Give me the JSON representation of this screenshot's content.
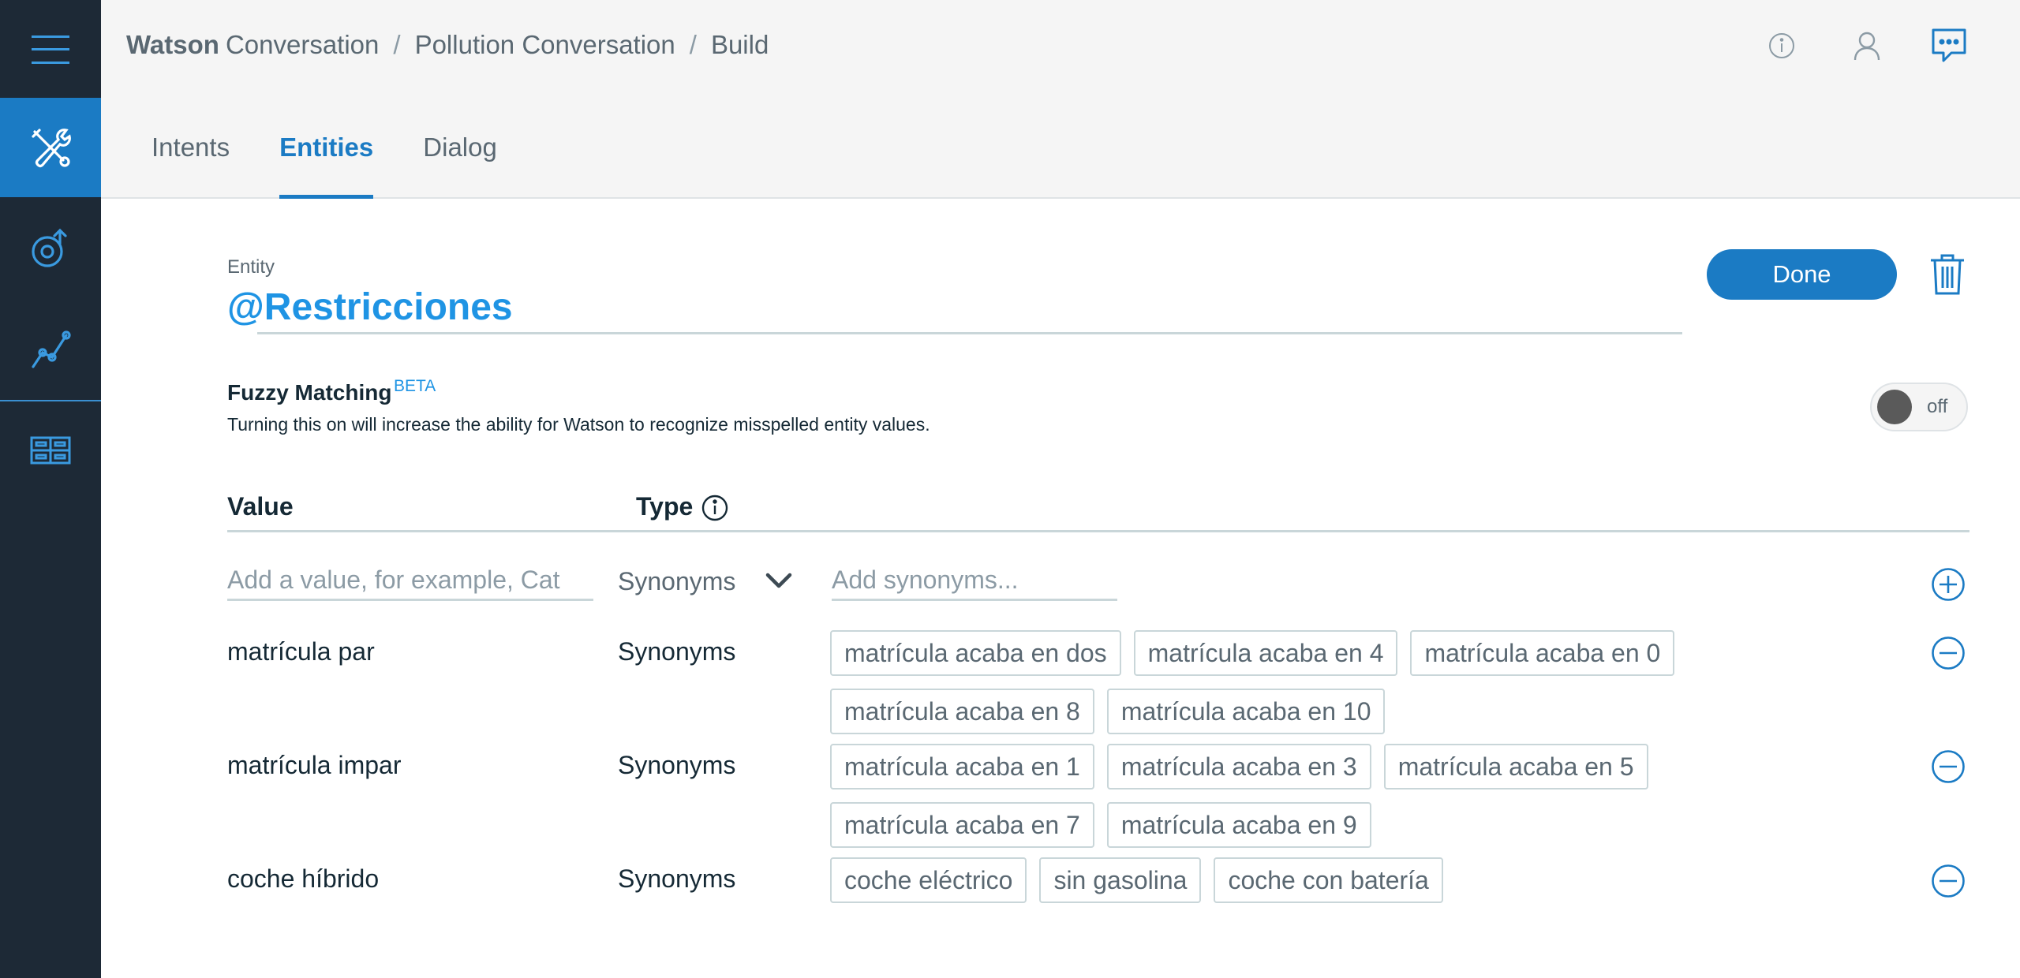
{
  "header": {
    "brand_strong": "Watson",
    "brand_rest": "Conversation",
    "separator": "/",
    "workspace": "Pollution Conversation",
    "section": "Build"
  },
  "tabs": [
    {
      "label": "Intents",
      "active": false
    },
    {
      "label": "Entities",
      "active": true
    },
    {
      "label": "Dialog",
      "active": false
    }
  ],
  "entity": {
    "label": "Entity",
    "name": "@Restricciones",
    "done_label": "Done"
  },
  "fuzzy": {
    "title": "Fuzzy Matching",
    "badge": "BETA",
    "description": "Turning this on will increase the ability for Watson to recognize misspelled entity values.",
    "toggle_label": "off",
    "enabled": false
  },
  "table": {
    "value_header": "Value",
    "type_header": "Type",
    "new_value_placeholder": "Add a value, for example, Cat",
    "new_type": "Synonyms",
    "new_synonyms_placeholder": "Add synonyms...",
    "rows": [
      {
        "value": "matrícula par",
        "type": "Synonyms",
        "synonyms": [
          "matrícula acaba en dos",
          "matrícula acaba en 4",
          "matrícula acaba en 0",
          "matrícula acaba en 8",
          "matrícula acaba en 10"
        ]
      },
      {
        "value": "matrícula impar",
        "type": "Synonyms",
        "synonyms": [
          "matrícula acaba en 1",
          "matrícula acaba en 3",
          "matrícula acaba en 5",
          "matrícula acaba en 7",
          "matrícula acaba en 9"
        ]
      },
      {
        "value": "coche híbrido",
        "type": "Synonyms",
        "synonyms": [
          "coche eléctrico",
          "sin gasolina",
          "coche con batería"
        ]
      }
    ]
  },
  "colors": {
    "rail": "#1d2936",
    "accent": "#1b7bc4",
    "entity_name": "#1f94e4"
  },
  "icons": {
    "rail": [
      "menu-icon",
      "build-tools-icon",
      "improve-icon",
      "analytics-icon",
      "workspaces-icon"
    ],
    "header": [
      "info-icon",
      "user-icon",
      "chat-icon"
    ]
  }
}
